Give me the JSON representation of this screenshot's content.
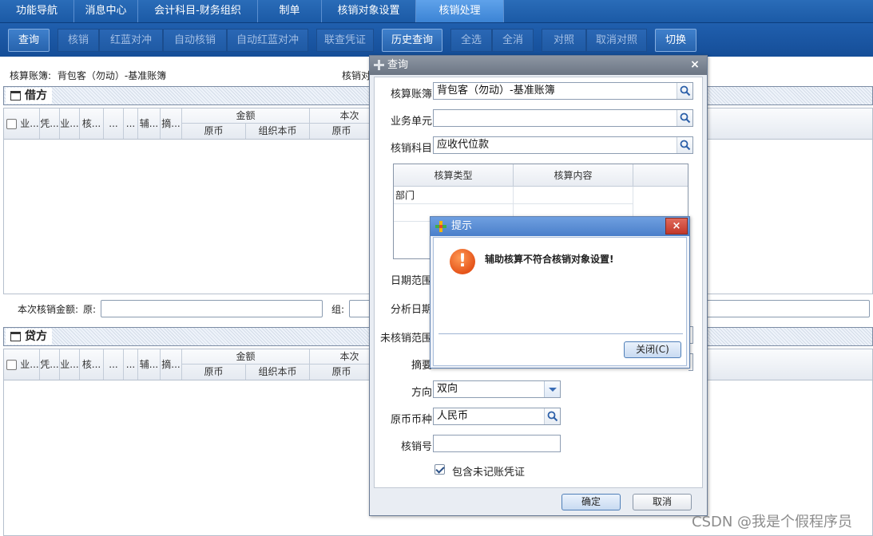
{
  "tabs": [
    {
      "label": "功能导航"
    },
    {
      "label": "消息中心"
    },
    {
      "label": "会计科目-财务组织"
    },
    {
      "label": "制单"
    },
    {
      "label": "核销对象设置"
    },
    {
      "label": "核销处理"
    }
  ],
  "toolbar": {
    "query": "查询",
    "writeoff": "核销",
    "red_blue": "红蓝对冲",
    "auto_writeoff": "自动核销",
    "auto_red_blue": "自动红蓝对冲",
    "linked_voucher": "联查凭证",
    "history_query": "历史查询",
    "select_all": "全选",
    "deselect_all": "全消",
    "match": "对照",
    "cancel_match": "取消对照",
    "switch": "切换"
  },
  "info": {
    "book_label": "核算账簿:",
    "book_value": "背包客（勿动）-基准账簿",
    "writeoff_partial": "核销对"
  },
  "debit": {
    "title": "借方",
    "columns": [
      "业...",
      "凭...",
      "业...",
      "核...",
      "...",
      "...",
      "辅...",
      "摘..."
    ],
    "amount_group": "金额",
    "current_group": "本次",
    "sub_original": "原币",
    "sub_org": "组织本币",
    "sub_original2": "原币"
  },
  "sum_row": {
    "label": "本次核销金额:",
    "orig_label": "原:",
    "org_label": "组:"
  },
  "credit": {
    "title": "贷方",
    "columns": [
      "业...",
      "凭...",
      "业...",
      "核...",
      "...",
      "...",
      "辅...",
      "摘..."
    ],
    "amount_group": "金额",
    "current_group": "本次",
    "sub_original": "原币",
    "sub_org": "组织本币",
    "sub_original2": "原币"
  },
  "query_dialog": {
    "title": "查询",
    "close": "×",
    "book_label": "核算账簿",
    "book_value": "背包客（勿动）-基准账簿",
    "unit_label": "业务单元",
    "unit_value": "",
    "subject_label": "核销科目",
    "subject_value": "应收代位款",
    "table_headers": [
      "核算类型",
      "核算内容"
    ],
    "table_rows": [
      [
        "部门",
        ""
      ],
      [
        "",
        ""
      ]
    ],
    "date_range_label": "日期范围",
    "analysis_date_label": "分析日期",
    "unwritten_range_label": "未核销范围",
    "summary_label": "摘要",
    "direction_label": "方向",
    "direction_value": "双向",
    "currency_label": "原币币种",
    "currency_value": "人民币",
    "writeoff_no_label": "核销号",
    "writeoff_no_value": "",
    "include_unposted": "包含未记账凭证",
    "ok": "确定",
    "cancel": "取消"
  },
  "alert": {
    "title": "提示",
    "close": "×",
    "message": "辅助核算不符合核销对象设置!",
    "close_button": "关闭(C)"
  },
  "watermark": "CSDN @我是个假程序员",
  "colors": {
    "tabbar": "#1b5aa6",
    "active_tab": "#4a91df",
    "toolbar": "#1a58a3",
    "warning": "#e5541a"
  }
}
